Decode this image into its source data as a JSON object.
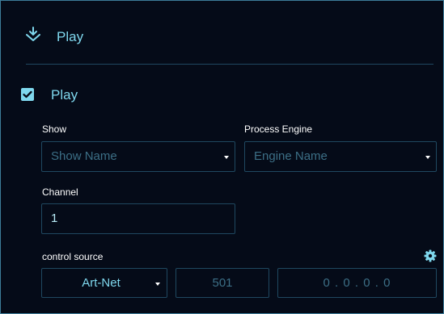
{
  "header": {
    "title": "Play",
    "icon": "download-arrow-icon"
  },
  "section": {
    "title": "Play",
    "checked": true
  },
  "show": {
    "label": "Show",
    "placeholder": "Show Name"
  },
  "process_engine": {
    "label": "Process Engine",
    "placeholder": "Engine Name"
  },
  "channel": {
    "label": "Channel",
    "value": "1"
  },
  "control_source": {
    "label": "control source",
    "protocol": "Art-Net",
    "port_placeholder": "501",
    "ip_placeholder": "0 . 0 . 0 . 0",
    "settings_icon": "gear-icon"
  },
  "colors": {
    "accent": "#7fd8ee",
    "border": "#1f4860",
    "background": "#050b18"
  }
}
